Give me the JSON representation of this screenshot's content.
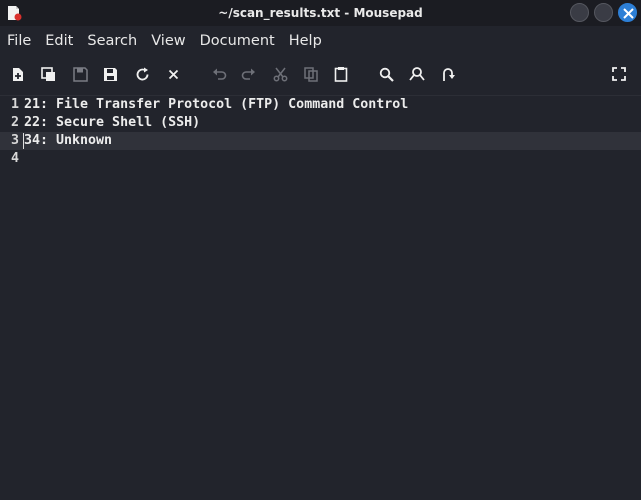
{
  "window": {
    "title": "~/scan_results.txt - Mousepad"
  },
  "menubar": {
    "items": [
      "File",
      "Edit",
      "Search",
      "View",
      "Document",
      "Help"
    ]
  },
  "toolbar": {
    "buttons": [
      "new-document",
      "new-window",
      "save",
      "save-as",
      "reload",
      "close",
      "undo",
      "redo",
      "cut",
      "copy",
      "paste",
      "find",
      "find-replace",
      "go-to-line",
      "fullscreen"
    ]
  },
  "editor": {
    "lines": [
      {
        "num": "1",
        "text": "21: File Transfer Protocol (FTP) Command Control"
      },
      {
        "num": "2",
        "text": "22: Secure Shell (SSH)"
      },
      {
        "num": "3",
        "text": "34: Unknown"
      },
      {
        "num": "4",
        "text": ""
      }
    ],
    "current_line": 3
  },
  "colors": {
    "background": "#22242c",
    "current_line": "#30323a",
    "accent": "#2d7fd6"
  }
}
